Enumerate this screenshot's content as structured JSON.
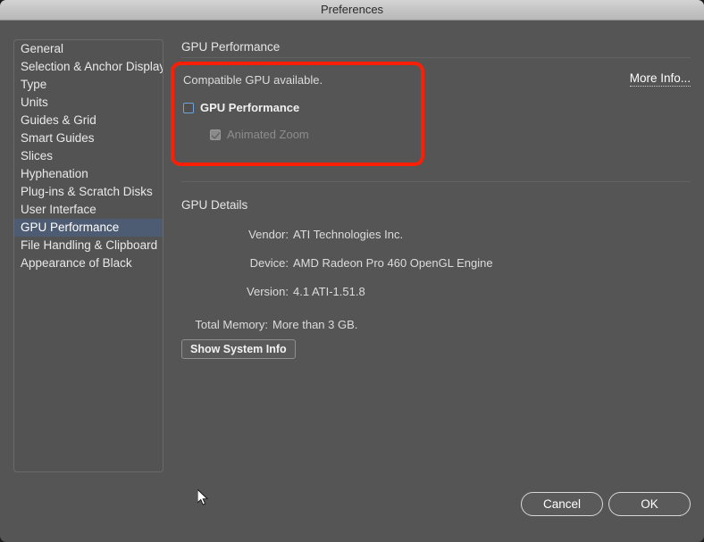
{
  "window": {
    "title": "Preferences"
  },
  "sidebar": {
    "items": [
      {
        "label": "General",
        "selected": false
      },
      {
        "label": "Selection & Anchor Display",
        "selected": false
      },
      {
        "label": "Type",
        "selected": false
      },
      {
        "label": "Units",
        "selected": false
      },
      {
        "label": "Guides & Grid",
        "selected": false
      },
      {
        "label": "Smart Guides",
        "selected": false
      },
      {
        "label": "Slices",
        "selected": false
      },
      {
        "label": "Hyphenation",
        "selected": false
      },
      {
        "label": "Plug-ins & Scratch Disks",
        "selected": false
      },
      {
        "label": "User Interface",
        "selected": false
      },
      {
        "label": "GPU Performance",
        "selected": true
      },
      {
        "label": "File Handling & Clipboard",
        "selected": false
      },
      {
        "label": "Appearance of Black",
        "selected": false
      }
    ]
  },
  "main": {
    "gpu_performance": {
      "header": "GPU Performance",
      "status_text": "Compatible GPU available.",
      "more_info_label": "More Info...",
      "checkboxes": [
        {
          "label": "GPU Performance",
          "checked": false,
          "disabled": false
        },
        {
          "label": "Animated Zoom",
          "checked": true,
          "disabled": true
        }
      ]
    },
    "gpu_details": {
      "header": "GPU Details",
      "rows": [
        {
          "label": "Vendor:",
          "value": "ATI Technologies Inc."
        },
        {
          "label": "Device:",
          "value": "AMD Radeon Pro 460 OpenGL Engine"
        },
        {
          "label": "Version:",
          "value": "4.1 ATI-1.51.8"
        },
        {
          "label": "Total Memory:",
          "value": "More than 3 GB."
        }
      ],
      "show_system_info_label": "Show System Info"
    }
  },
  "footer": {
    "cancel_label": "Cancel",
    "ok_label": "OK"
  },
  "annotation": {
    "highlight_color": "#fb1f06"
  }
}
